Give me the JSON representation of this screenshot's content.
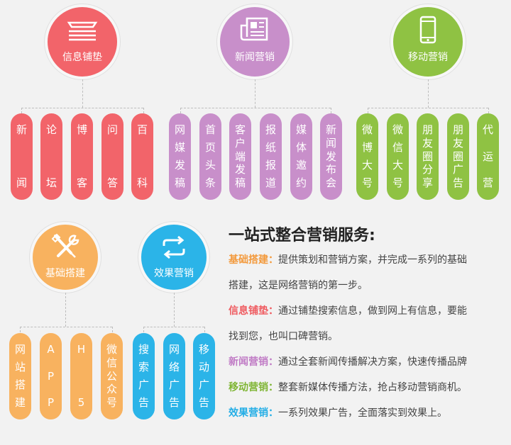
{
  "colors": {
    "red": "#f2646a",
    "purple": "#c88fca",
    "green": "#8fc243",
    "orange": "#f8b25f",
    "blue": "#2bb4e8"
  },
  "circles": {
    "info": {
      "label": "信息铺垫",
      "icon": "stack-icon"
    },
    "news": {
      "label": "新闻营销",
      "icon": "newspaper-icon"
    },
    "mobile": {
      "label": "移动营销",
      "icon": "phone-icon"
    },
    "infra": {
      "label": "基础搭建",
      "icon": "tools-icon"
    },
    "effect": {
      "label": "效果营销",
      "icon": "refresh-icon"
    }
  },
  "pills": {
    "info": [
      [
        "新",
        "闻"
      ],
      [
        "论",
        "坛"
      ],
      [
        "博",
        "客"
      ],
      [
        "问",
        "答"
      ],
      [
        "百",
        "科"
      ]
    ],
    "news": [
      [
        "网",
        "媒",
        "发",
        "稿"
      ],
      [
        "首",
        "页",
        "头",
        "条"
      ],
      [
        "客",
        "户",
        "端",
        "发",
        "稿"
      ],
      [
        "报",
        "纸",
        "报",
        "道"
      ],
      [
        "媒",
        "体",
        "邀",
        "约"
      ],
      [
        "新",
        "闻",
        "发",
        "布",
        "会"
      ]
    ],
    "mobile": [
      [
        "微",
        "博",
        "大",
        "号"
      ],
      [
        "微",
        "信",
        "大",
        "号"
      ],
      [
        "朋",
        "友",
        "圈",
        "分",
        "享"
      ],
      [
        "朋",
        "友",
        "圈",
        "广",
        "告"
      ],
      [
        "代",
        "运",
        "营"
      ]
    ],
    "infra": [
      [
        "网",
        "站",
        "搭",
        "建"
      ],
      [
        "A",
        "P",
        "P"
      ],
      [
        "H",
        "5"
      ],
      [
        "微",
        "信",
        "公",
        "众",
        "号"
      ]
    ],
    "effect": [
      [
        "搜",
        "索",
        "广",
        "告"
      ],
      [
        "网",
        "络",
        "广",
        "告"
      ],
      [
        "移",
        "动",
        "广",
        "告"
      ]
    ]
  },
  "summary": {
    "title": "一站式整合营销服务:",
    "lines": [
      {
        "key": "基础搭建：",
        "text": "提供策划和营销方案，并完成一系列的基础",
        "color": "#f39a3d"
      },
      {
        "key": "",
        "text": "搭建，这是网络营销的第一步。",
        "color": ""
      },
      {
        "key": "信息铺垫：",
        "text": "通过铺垫搜索信息，做到网上有信息，要能",
        "color": "#ef5a5f"
      },
      {
        "key": "",
        "text": "找到您，也叫口碑营销。",
        "color": ""
      },
      {
        "key": "新闻营销：",
        "text": "通过全套新闻传播解决方案，快速传播品牌",
        "color": "#c07bc5"
      },
      {
        "key": "移动营销：",
        "text": "整套新媒体传播方法，抢占移动营销商机。",
        "color": "#7fb534"
      },
      {
        "key": "效果营销：",
        "text": "一系列效果广告，全面落实到效果上。",
        "color": "#24aee6"
      }
    ]
  }
}
